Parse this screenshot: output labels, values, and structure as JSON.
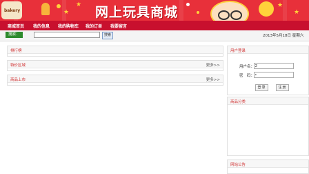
{
  "banner": {
    "title": "网上玩具商城",
    "logo_text": "bakery"
  },
  "nav": {
    "items": [
      "商城首页",
      "我的信息",
      "我的购物车",
      "我的订单",
      "我要留言"
    ]
  },
  "search": {
    "label": "搜索：",
    "value": "",
    "button": "搜索",
    "date": "2013年5月18日 星期六"
  },
  "panels": {
    "ranking": {
      "title": "排行榜"
    },
    "special": {
      "title": "特价区域",
      "more": "更多>>"
    },
    "new": {
      "title": "商品上市",
      "more": "更多>>"
    }
  },
  "login": {
    "title": "用户登录",
    "username_label": "用户名：",
    "username_value": "2",
    "password_label": "密　码：",
    "password_value": "•",
    "login_button": "登录",
    "register_button": "注册"
  },
  "category": {
    "title": "商品分类"
  },
  "notice": {
    "title": "网站公告"
  },
  "colors": {
    "banner": "#e8303a",
    "nav": "#c8102e",
    "panel_title": "#d03030",
    "search_label": "#2e8b2e"
  }
}
